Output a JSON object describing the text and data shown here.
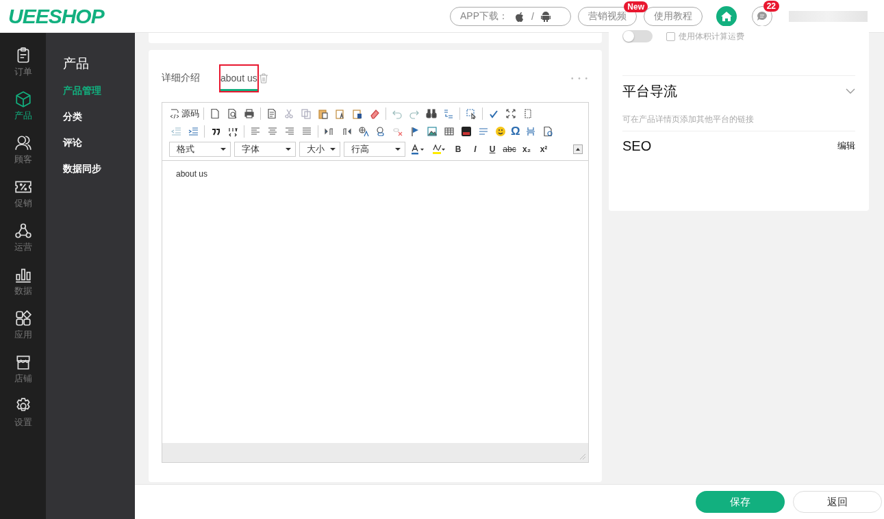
{
  "header": {
    "logo": "UEESHOP",
    "app_download": {
      "label": "APP下载：",
      "separator": "/"
    },
    "buttons": [
      {
        "label": "营销视频",
        "badge": "New"
      },
      {
        "label": "使用教程"
      }
    ],
    "messages_badge": "22"
  },
  "rail": [
    {
      "label": "订单",
      "selected": false
    },
    {
      "label": "产品",
      "selected": true
    },
    {
      "label": "顾客",
      "selected": false
    },
    {
      "label": "促销",
      "selected": false
    },
    {
      "label": "运营",
      "selected": false
    },
    {
      "label": "数据",
      "selected": false
    },
    {
      "label": "应用",
      "selected": false
    },
    {
      "label": "店铺",
      "selected": false
    },
    {
      "label": "设置",
      "selected": false
    }
  ],
  "submenu": {
    "title": "产品",
    "items": [
      {
        "label": "产品管理",
        "selected": true
      },
      {
        "label": "分类",
        "selected": false
      },
      {
        "label": "评论",
        "selected": false
      },
      {
        "label": "数据同步",
        "selected": false
      }
    ]
  },
  "editor_card": {
    "tabs": [
      {
        "label": "详细介绍",
        "selected": false,
        "highlighted": false
      },
      {
        "label": "about us",
        "selected": true,
        "highlighted": true
      }
    ],
    "more": "• • •",
    "toolbar": {
      "source": "源码",
      "selects": [
        "格式",
        "字体",
        "大小",
        "行高"
      ],
      "format_buttons": [
        "B",
        "I",
        "U",
        "abc",
        "x₂",
        "x²"
      ],
      "special_char": "Ω"
    },
    "content": "about us"
  },
  "side_card": {
    "shipping_toggle": {
      "on": false
    },
    "volume_checkbox": {
      "label": "使用体积计算运费",
      "checked": false
    },
    "platform": {
      "title": "平台导流",
      "expanded": false,
      "hint": "可在产品详情页添加其他平台的链接"
    },
    "seo": {
      "title": "SEO",
      "action": "编辑"
    }
  },
  "footer": {
    "save": "保存",
    "back": "返回"
  }
}
